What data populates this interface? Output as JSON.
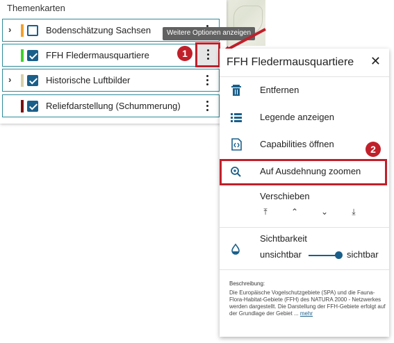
{
  "panel": {
    "title": "Themenkarten",
    "layers": [
      {
        "name": "Bodenschätzung Sachsen",
        "color": "#f2a12b",
        "checked": false,
        "expandable": true
      },
      {
        "name": "FFH Fledermausquartiere",
        "color": "#3fd12a",
        "checked": true,
        "expandable": false
      },
      {
        "name": "Historische Luftbilder",
        "color": "#d8cfa8",
        "checked": true,
        "expandable": true
      },
      {
        "name": "Reliefdarstellung (Schummerung)",
        "color": "#7a0f0f",
        "checked": true,
        "expandable": false
      }
    ]
  },
  "tooltip": "Weitere Optionen anzeigen",
  "markers": [
    "1",
    "2"
  ],
  "menu": {
    "title": "FFH Fledermausquartiere",
    "items": [
      {
        "label": "Entfernen",
        "icon": "trash-icon"
      },
      {
        "label": "Legende anzeigen",
        "icon": "list-icon"
      },
      {
        "label": "Capabilities öffnen",
        "icon": "code-file-icon"
      },
      {
        "label": "Auf Ausdehnung zoomen",
        "icon": "zoom-in-icon"
      }
    ],
    "move_label": "Verschieben",
    "visibility_label": "Sichtbarkeit",
    "visibility_left": "unsichtbar",
    "visibility_right": "sichtbar",
    "visibility_value": 1.0,
    "description_label": "Beschreibung:",
    "description": "Die Europäische Vogelschutzgebiete (SPA) und die Fauna-Flora-Habitat-Gebiete (FFH) des NATURA 2000 - Netzwerkes werden dargestellt. Die Darstellung der FFH-Gebiete erfolgt auf der Grundlage der Gebiet ...",
    "more_link": "mehr"
  },
  "colors": {
    "accent": "#1a5f8a",
    "border": "#2e8a98",
    "annotation": "#c0202a"
  }
}
